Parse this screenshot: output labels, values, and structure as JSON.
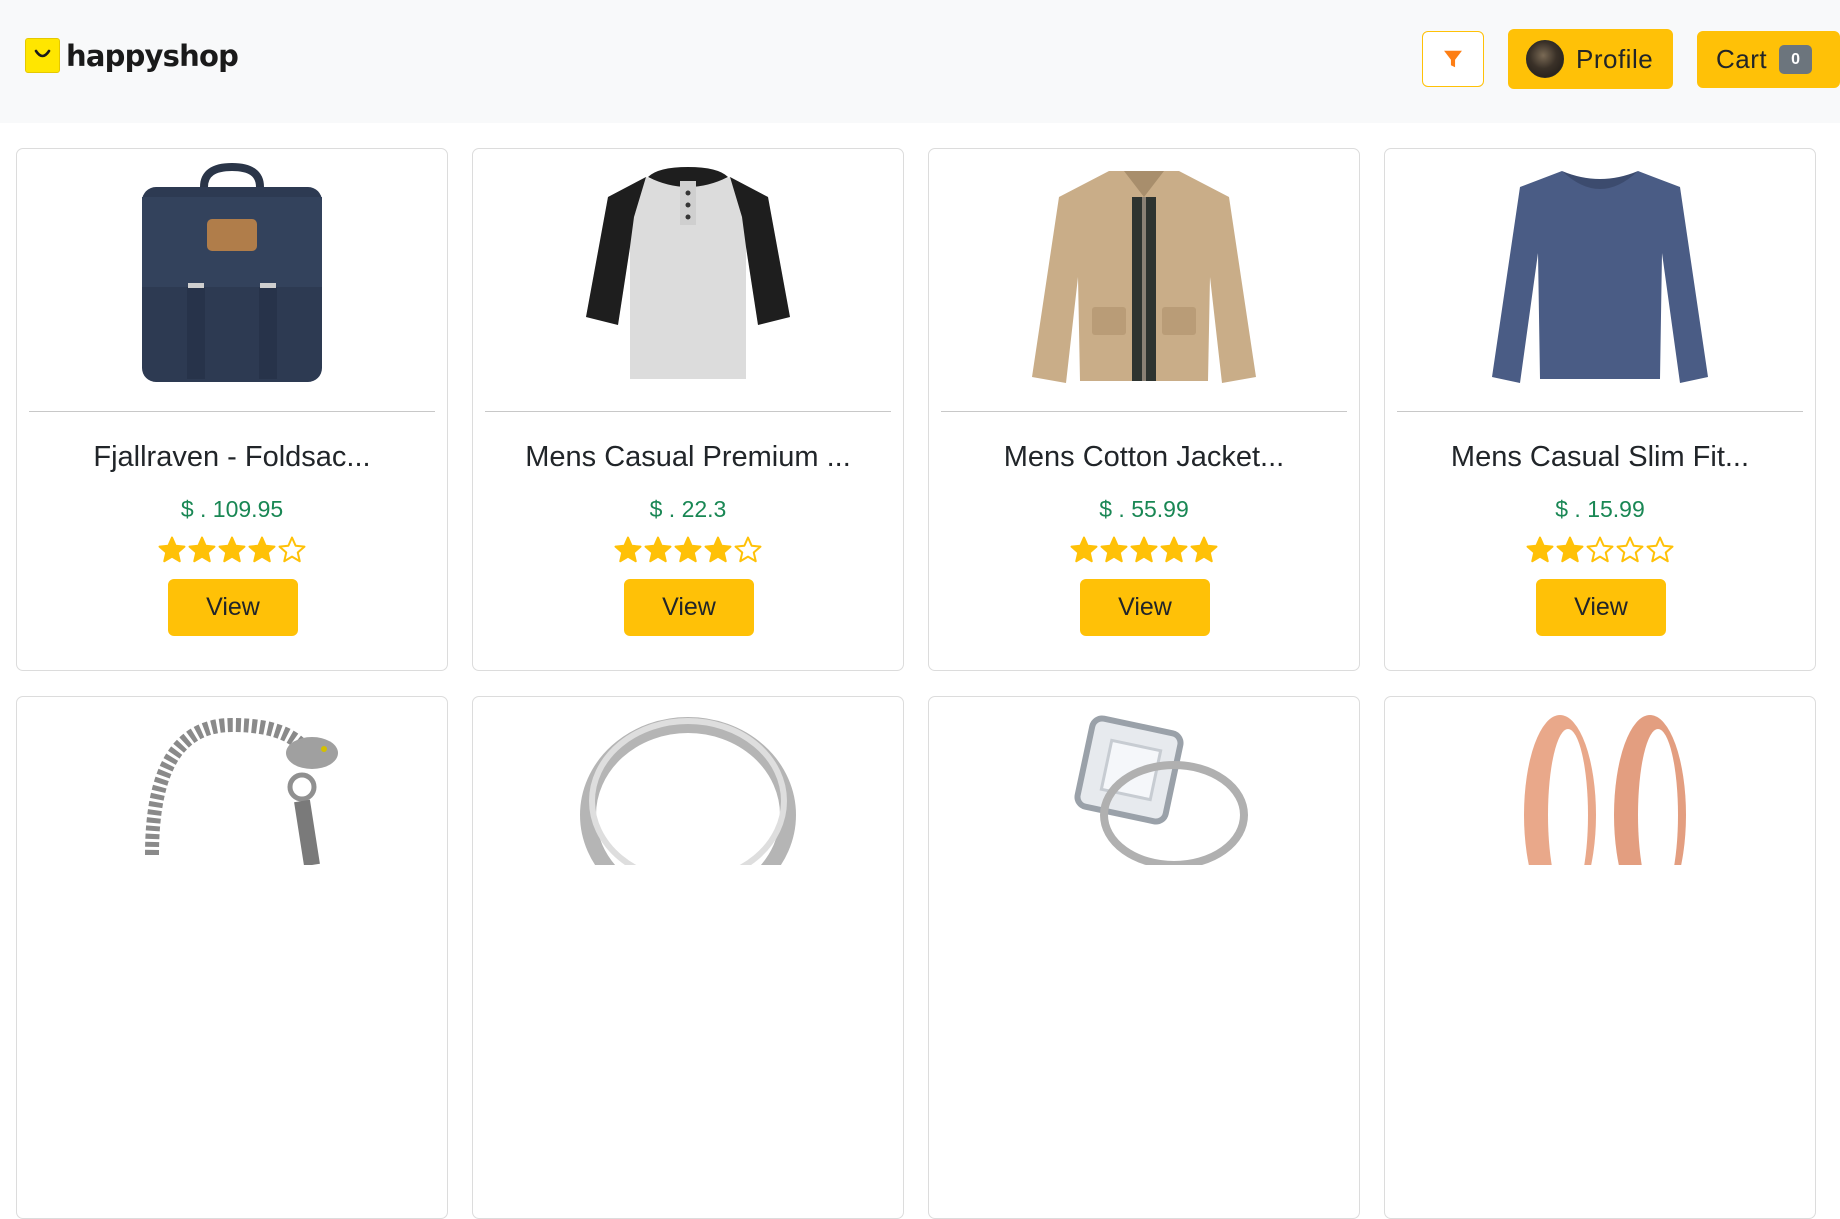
{
  "brand": {
    "name": "happyshop",
    "logo": "shopping-bag-smile-icon",
    "logo_color": "#ffe600"
  },
  "nav": {
    "filter_icon": "filter-icon",
    "profile_label": "Profile",
    "cart_label": "Cart",
    "cart_count": "0"
  },
  "colors": {
    "accent": "#ffc107",
    "price": "#198754",
    "badge": "#6c757d",
    "navbar_bg": "#f8f9fa"
  },
  "products": [
    {
      "title": "Fjallraven - Foldsac...",
      "price": "$ . 109.95",
      "rating": 4,
      "view_label": "View",
      "image": "navy-backpack-image"
    },
    {
      "title": "Mens Casual Premium ...",
      "price": "$ . 22.3",
      "rating": 4,
      "view_label": "View",
      "image": "raglan-tshirt-image"
    },
    {
      "title": "Mens Cotton Jacket...",
      "price": "$ . 55.99",
      "rating": 5,
      "view_label": "View",
      "image": "khaki-jacket-image"
    },
    {
      "title": "Mens Casual Slim Fit...",
      "price": "$ . 15.99",
      "rating": 2,
      "view_label": "View",
      "image": "blue-longsleeve-image"
    },
    {
      "image": "dragon-bracelet-image"
    },
    {
      "image": "silver-ring-image"
    },
    {
      "image": "diamond-ring-image"
    },
    {
      "image": "rose-gold-tunnels-image"
    }
  ]
}
